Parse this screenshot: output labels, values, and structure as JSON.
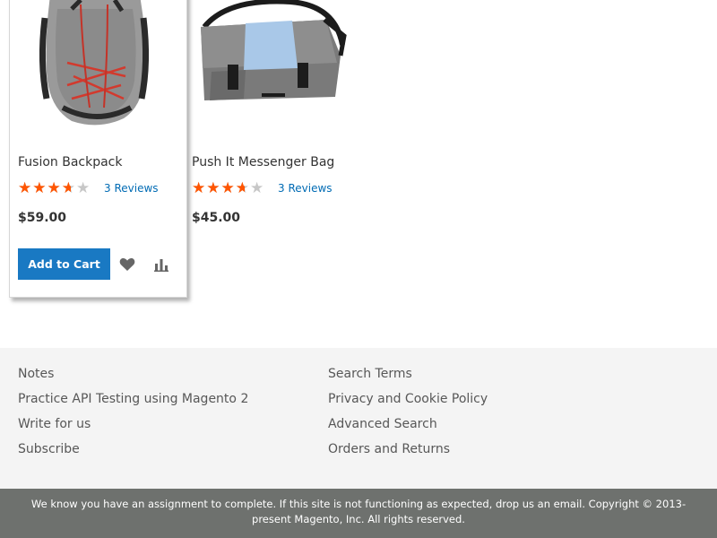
{
  "products": [
    {
      "name": "Fusion Backpack",
      "rating_percent": 67,
      "reviews_label": "3 Reviews",
      "price": "$59.00",
      "add_to_cart_label": "Add to Cart",
      "image_icon": "backpack-image"
    },
    {
      "name": "Push It Messenger Bag",
      "rating_percent": 67,
      "reviews_label": "3 Reviews",
      "price": "$45.00",
      "image_icon": "messenger-bag-image"
    }
  ],
  "colors": {
    "accent_blue": "#1979c3",
    "link_blue": "#006bb4",
    "star_orange": "#ff5501",
    "star_empty": "#c7c7c7",
    "footer_bg": "#f4f4f4",
    "copyright_bg": "#6e716e"
  },
  "footer": {
    "column1": [
      "Notes",
      "Practice API Testing using Magento 2",
      "Write for us",
      "Subscribe"
    ],
    "column2": [
      "Search Terms",
      "Privacy and Cookie Policy",
      "Advanced Search",
      "Orders and Returns"
    ]
  },
  "copyright": "We know you have an assignment to complete. If this site is not functioning as expected, drop us an email. Copyright © 2013-present Magento, Inc. All rights reserved.",
  "icons": {
    "wishlist": "heart-icon",
    "compare": "bar-chart-icon"
  }
}
